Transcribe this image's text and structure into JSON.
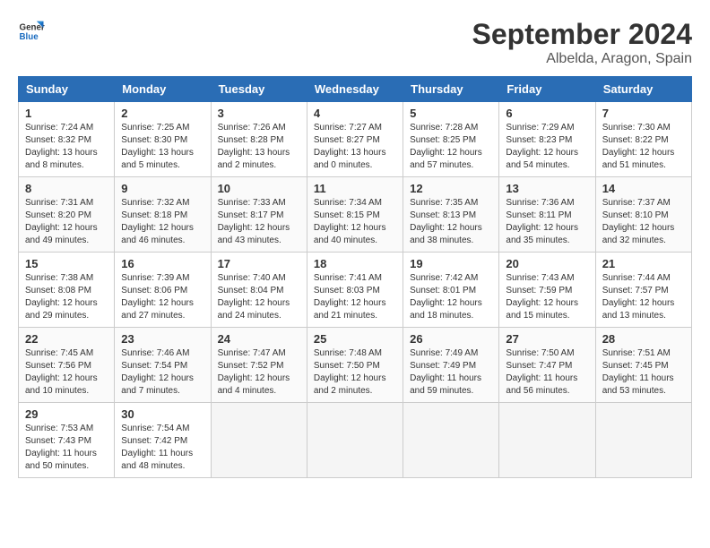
{
  "logo": {
    "line1": "General",
    "line2": "Blue"
  },
  "title": "September 2024",
  "location": "Albelda, Aragon, Spain",
  "days_of_week": [
    "Sunday",
    "Monday",
    "Tuesday",
    "Wednesday",
    "Thursday",
    "Friday",
    "Saturday"
  ],
  "weeks": [
    [
      {
        "day": 1,
        "info": "Sunrise: 7:24 AM\nSunset: 8:32 PM\nDaylight: 13 hours\nand 8 minutes."
      },
      {
        "day": 2,
        "info": "Sunrise: 7:25 AM\nSunset: 8:30 PM\nDaylight: 13 hours\nand 5 minutes."
      },
      {
        "day": 3,
        "info": "Sunrise: 7:26 AM\nSunset: 8:28 PM\nDaylight: 13 hours\nand 2 minutes."
      },
      {
        "day": 4,
        "info": "Sunrise: 7:27 AM\nSunset: 8:27 PM\nDaylight: 13 hours\nand 0 minutes."
      },
      {
        "day": 5,
        "info": "Sunrise: 7:28 AM\nSunset: 8:25 PM\nDaylight: 12 hours\nand 57 minutes."
      },
      {
        "day": 6,
        "info": "Sunrise: 7:29 AM\nSunset: 8:23 PM\nDaylight: 12 hours\nand 54 minutes."
      },
      {
        "day": 7,
        "info": "Sunrise: 7:30 AM\nSunset: 8:22 PM\nDaylight: 12 hours\nand 51 minutes."
      }
    ],
    [
      {
        "day": 8,
        "info": "Sunrise: 7:31 AM\nSunset: 8:20 PM\nDaylight: 12 hours\nand 49 minutes."
      },
      {
        "day": 9,
        "info": "Sunrise: 7:32 AM\nSunset: 8:18 PM\nDaylight: 12 hours\nand 46 minutes."
      },
      {
        "day": 10,
        "info": "Sunrise: 7:33 AM\nSunset: 8:17 PM\nDaylight: 12 hours\nand 43 minutes."
      },
      {
        "day": 11,
        "info": "Sunrise: 7:34 AM\nSunset: 8:15 PM\nDaylight: 12 hours\nand 40 minutes."
      },
      {
        "day": 12,
        "info": "Sunrise: 7:35 AM\nSunset: 8:13 PM\nDaylight: 12 hours\nand 38 minutes."
      },
      {
        "day": 13,
        "info": "Sunrise: 7:36 AM\nSunset: 8:11 PM\nDaylight: 12 hours\nand 35 minutes."
      },
      {
        "day": 14,
        "info": "Sunrise: 7:37 AM\nSunset: 8:10 PM\nDaylight: 12 hours\nand 32 minutes."
      }
    ],
    [
      {
        "day": 15,
        "info": "Sunrise: 7:38 AM\nSunset: 8:08 PM\nDaylight: 12 hours\nand 29 minutes."
      },
      {
        "day": 16,
        "info": "Sunrise: 7:39 AM\nSunset: 8:06 PM\nDaylight: 12 hours\nand 27 minutes."
      },
      {
        "day": 17,
        "info": "Sunrise: 7:40 AM\nSunset: 8:04 PM\nDaylight: 12 hours\nand 24 minutes."
      },
      {
        "day": 18,
        "info": "Sunrise: 7:41 AM\nSunset: 8:03 PM\nDaylight: 12 hours\nand 21 minutes."
      },
      {
        "day": 19,
        "info": "Sunrise: 7:42 AM\nSunset: 8:01 PM\nDaylight: 12 hours\nand 18 minutes."
      },
      {
        "day": 20,
        "info": "Sunrise: 7:43 AM\nSunset: 7:59 PM\nDaylight: 12 hours\nand 15 minutes."
      },
      {
        "day": 21,
        "info": "Sunrise: 7:44 AM\nSunset: 7:57 PM\nDaylight: 12 hours\nand 13 minutes."
      }
    ],
    [
      {
        "day": 22,
        "info": "Sunrise: 7:45 AM\nSunset: 7:56 PM\nDaylight: 12 hours\nand 10 minutes."
      },
      {
        "day": 23,
        "info": "Sunrise: 7:46 AM\nSunset: 7:54 PM\nDaylight: 12 hours\nand 7 minutes."
      },
      {
        "day": 24,
        "info": "Sunrise: 7:47 AM\nSunset: 7:52 PM\nDaylight: 12 hours\nand 4 minutes."
      },
      {
        "day": 25,
        "info": "Sunrise: 7:48 AM\nSunset: 7:50 PM\nDaylight: 12 hours\nand 2 minutes."
      },
      {
        "day": 26,
        "info": "Sunrise: 7:49 AM\nSunset: 7:49 PM\nDaylight: 11 hours\nand 59 minutes."
      },
      {
        "day": 27,
        "info": "Sunrise: 7:50 AM\nSunset: 7:47 PM\nDaylight: 11 hours\nand 56 minutes."
      },
      {
        "day": 28,
        "info": "Sunrise: 7:51 AM\nSunset: 7:45 PM\nDaylight: 11 hours\nand 53 minutes."
      }
    ],
    [
      {
        "day": 29,
        "info": "Sunrise: 7:53 AM\nSunset: 7:43 PM\nDaylight: 11 hours\nand 50 minutes."
      },
      {
        "day": 30,
        "info": "Sunrise: 7:54 AM\nSunset: 7:42 PM\nDaylight: 11 hours\nand 48 minutes."
      },
      null,
      null,
      null,
      null,
      null
    ]
  ]
}
